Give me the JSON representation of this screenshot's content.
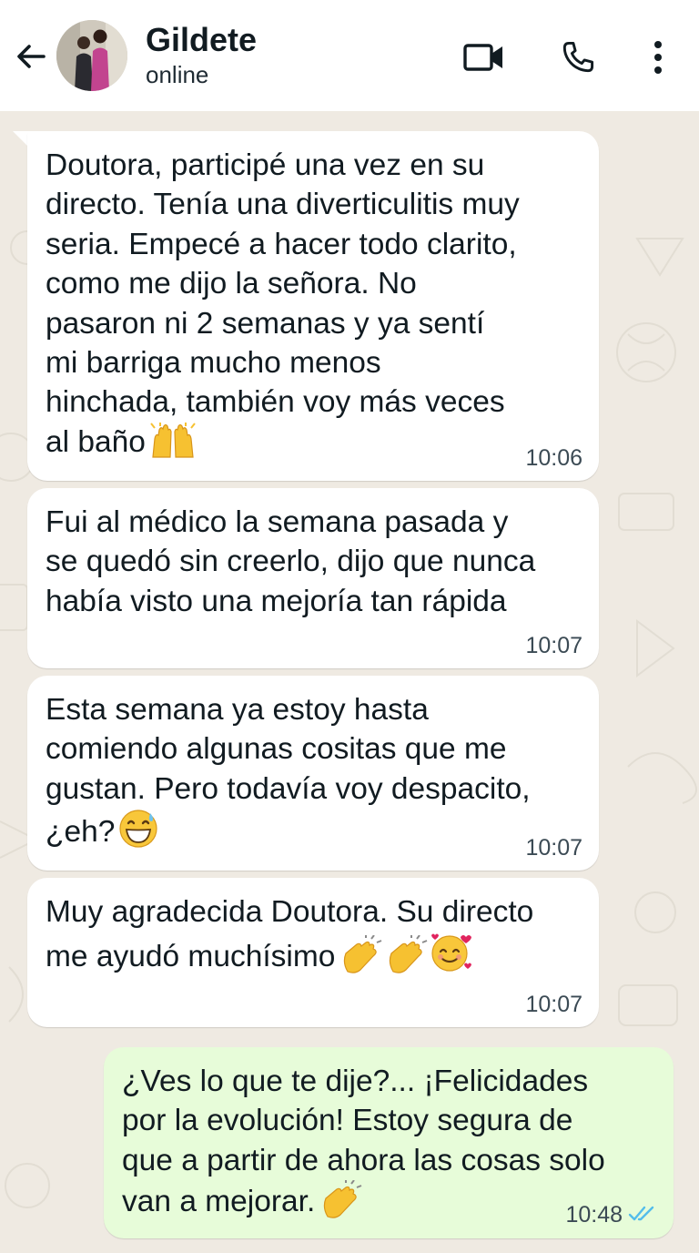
{
  "header": {
    "contact_name": "Gildete",
    "contact_status": "online",
    "icons": [
      "back-arrow-icon",
      "video-call-icon",
      "voice-call-icon",
      "more-options-icon"
    ]
  },
  "colors": {
    "header_bg": "#ffffff",
    "chat_bg": "#efeae2",
    "incoming_bubble": "#ffffff",
    "outgoing_bubble": "#e7fcd9",
    "read_ticks": "#53bdeb"
  },
  "messages": [
    {
      "direction": "in",
      "text": "Doutora, participé una vez en su\ndirecto. Tenía una diverticulitis muy\nseria. Empecé a hacer todo clarito,\ncomo me dijo la señora. No\npasaron ni 2 semanas y ya sentí\nmi barriga mucho menos\nhinchada, también voy más veces\nal baño",
      "emojis": [
        "raising-hands-emoji"
      ],
      "time": "10:06"
    },
    {
      "direction": "in",
      "text": "Fui al médico la semana pasada y\nse quedó sin creerlo, dijo que nunca\nhabía visto una mejoría tan rápida",
      "emojis": [],
      "time": "10:07"
    },
    {
      "direction": "in",
      "text": "Esta semana ya estoy hasta\ncomiendo algunas cositas que me\ngustan. Pero todavía voy despacito,\n¿eh?",
      "emojis": [
        "grinning-sweat-emoji"
      ],
      "time": "10:07"
    },
    {
      "direction": "in",
      "text": "Muy agradecida Doutora. Su directo\nme ayudó muchísimo",
      "emojis": [
        "clapping-hands-emoji",
        "clapping-hands-emoji",
        "smiling-face-with-hearts-emoji"
      ],
      "time": "10:07"
    },
    {
      "direction": "out",
      "text": "¿Ves lo que te dije?... ¡Felicidades\npor la evolución! Estoy segura de\nque a partir de ahora las cosas solo\nvan a mejorar.",
      "emojis": [
        "clapping-hands-emoji"
      ],
      "time": "10:48",
      "status": "read"
    }
  ]
}
